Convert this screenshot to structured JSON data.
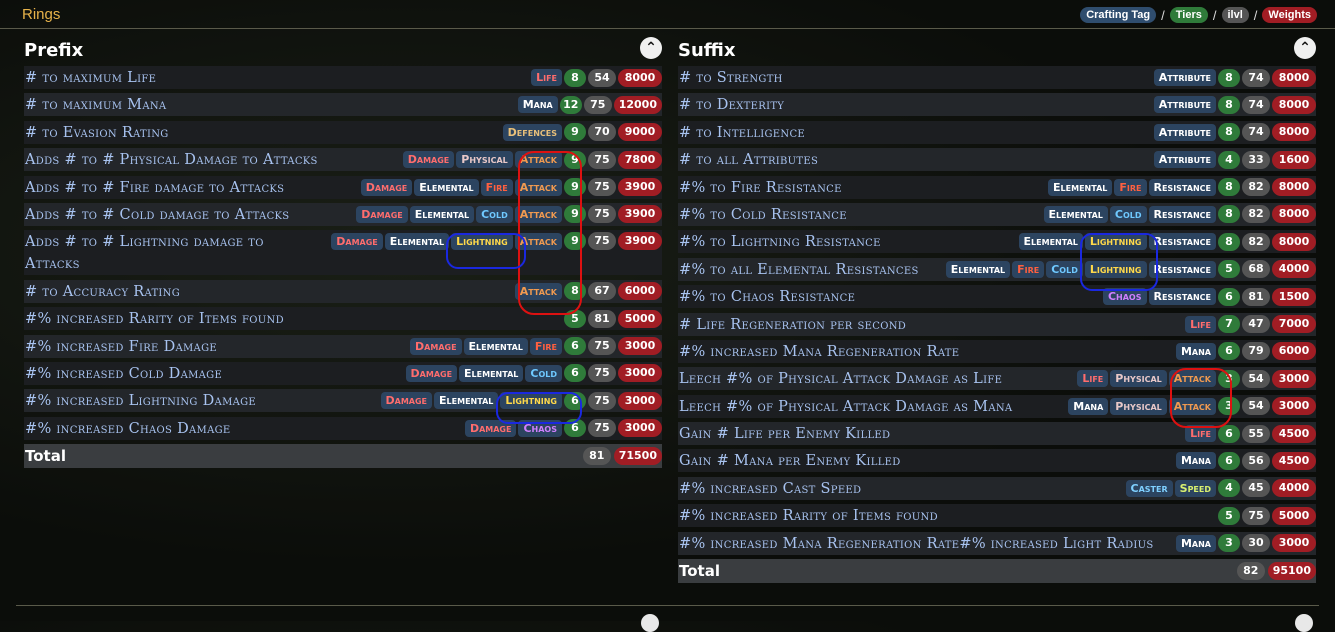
{
  "page": {
    "title": "Rings"
  },
  "legend": {
    "tag": "Crafting Tag",
    "tiers": "Tiers",
    "ilvl": "ilvl",
    "weights": "Weights",
    "sep": "/"
  },
  "prefix": {
    "title": "Prefix",
    "rows": [
      {
        "mod": "# to maximum Life",
        "tags": [
          [
            "Life",
            "life"
          ]
        ],
        "tier": "8",
        "ilvl": "54",
        "weight": "8000"
      },
      {
        "mod": "# to maximum Mana",
        "tags": [
          [
            "Mana",
            "mana"
          ]
        ],
        "tier": "12",
        "ilvl": "75",
        "weight": "12000"
      },
      {
        "mod": "# to Evasion Rating",
        "tags": [
          [
            "Defences",
            "defences"
          ]
        ],
        "tier": "9",
        "ilvl": "70",
        "weight": "9000"
      },
      {
        "mod": "Adds # to # Physical Damage to Attacks",
        "tags": [
          [
            "Damage",
            "damage"
          ],
          [
            "Physical",
            "physical"
          ],
          [
            "Attack",
            "attack"
          ]
        ],
        "tier": "9",
        "ilvl": "75",
        "weight": "7800"
      },
      {
        "mod": "Adds # to # Fire damage to Attacks",
        "tags": [
          [
            "Damage",
            "damage"
          ],
          [
            "Elemental",
            "elemental"
          ],
          [
            "Fire",
            "fire"
          ],
          [
            "Attack",
            "attack"
          ]
        ],
        "tier": "9",
        "ilvl": "75",
        "weight": "3900"
      },
      {
        "mod": "Adds # to # Cold damage to Attacks",
        "tags": [
          [
            "Damage",
            "damage"
          ],
          [
            "Elemental",
            "elemental"
          ],
          [
            "Cold",
            "cold"
          ],
          [
            "Attack",
            "attack"
          ]
        ],
        "tier": "9",
        "ilvl": "75",
        "weight": "3900"
      },
      {
        "mod": "Adds # to # Lightning damage to Attacks",
        "tags": [
          [
            "Damage",
            "damage"
          ],
          [
            "Elemental",
            "elemental"
          ],
          [
            "Lightning",
            "lightning"
          ],
          [
            "Attack",
            "attack"
          ]
        ],
        "tier": "9",
        "ilvl": "75",
        "weight": "3900",
        "tall": true
      },
      {
        "mod": "# to Accuracy Rating",
        "tags": [
          [
            "Attack",
            "attack"
          ]
        ],
        "tier": "8",
        "ilvl": "67",
        "weight": "6000"
      },
      {
        "mod": "#% increased Rarity of Items found",
        "tags": [],
        "tier": "5",
        "ilvl": "81",
        "weight": "5000"
      },
      {
        "mod": "#% increased Fire Damage",
        "tags": [
          [
            "Damage",
            "damage"
          ],
          [
            "Elemental",
            "elemental"
          ],
          [
            "Fire",
            "fire"
          ]
        ],
        "tier": "6",
        "ilvl": "75",
        "weight": "3000"
      },
      {
        "mod": "#% increased Cold Damage",
        "tags": [
          [
            "Damage",
            "damage"
          ],
          [
            "Elemental",
            "elemental"
          ],
          [
            "Cold",
            "cold"
          ]
        ],
        "tier": "6",
        "ilvl": "75",
        "weight": "3000"
      },
      {
        "mod": "#% increased Lightning Damage",
        "tags": [
          [
            "Damage",
            "damage"
          ],
          [
            "Elemental",
            "elemental"
          ],
          [
            "Lightning",
            "lightning"
          ]
        ],
        "tier": "6",
        "ilvl": "75",
        "weight": "3000"
      },
      {
        "mod": "#% increased Chaos Damage",
        "tags": [
          [
            "Damage",
            "damage"
          ],
          [
            "Chaos",
            "chaos"
          ]
        ],
        "tier": "6",
        "ilvl": "75",
        "weight": "3000"
      }
    ],
    "total": {
      "label": "Total",
      "ilvl": "81",
      "weight": "71500"
    }
  },
  "suffix": {
    "title": "Suffix",
    "rows": [
      {
        "mod": "# to Strength",
        "tags": [
          [
            "Attribute",
            "attribute"
          ]
        ],
        "tier": "8",
        "ilvl": "74",
        "weight": "8000"
      },
      {
        "mod": "# to Dexterity",
        "tags": [
          [
            "Attribute",
            "attribute"
          ]
        ],
        "tier": "8",
        "ilvl": "74",
        "weight": "8000"
      },
      {
        "mod": "# to Intelligence",
        "tags": [
          [
            "Attribute",
            "attribute"
          ]
        ],
        "tier": "8",
        "ilvl": "74",
        "weight": "8000"
      },
      {
        "mod": "# to all Attributes",
        "tags": [
          [
            "Attribute",
            "attribute"
          ]
        ],
        "tier": "4",
        "ilvl": "33",
        "weight": "1600"
      },
      {
        "mod": "#% to Fire Resistance",
        "tags": [
          [
            "Elemental",
            "elemental"
          ],
          [
            "Fire",
            "fire"
          ],
          [
            "Resistance",
            "resistance"
          ]
        ],
        "tier": "8",
        "ilvl": "82",
        "weight": "8000"
      },
      {
        "mod": "#% to Cold Resistance",
        "tags": [
          [
            "Elemental",
            "elemental"
          ],
          [
            "Cold",
            "cold"
          ],
          [
            "Resistance",
            "resistance"
          ]
        ],
        "tier": "8",
        "ilvl": "82",
        "weight": "8000"
      },
      {
        "mod": "#% to Lightning Resistance",
        "tags": [
          [
            "Elemental",
            "elemental"
          ],
          [
            "Lightning",
            "lightning"
          ],
          [
            "Resistance",
            "resistance"
          ]
        ],
        "tier": "8",
        "ilvl": "82",
        "weight": "8000"
      },
      {
        "mod": "#% to all Elemental Resistances",
        "tags": [
          [
            "Elemental",
            "elemental"
          ],
          [
            "Fire",
            "fire"
          ],
          [
            "Cold",
            "cold"
          ],
          [
            "Lightning",
            "lightning"
          ],
          [
            "Resistance",
            "resistance"
          ]
        ],
        "tier": "5",
        "ilvl": "68",
        "weight": "4000"
      },
      {
        "mod": "#% to Chaos Resistance",
        "tags": [
          [
            "Chaos",
            "chaos"
          ],
          [
            "Resistance",
            "resistance"
          ]
        ],
        "tier": "6",
        "ilvl": "81",
        "weight": "1500"
      },
      {
        "mod": "# Life Regeneration per second",
        "tags": [
          [
            "Life",
            "life"
          ]
        ],
        "tier": "7",
        "ilvl": "47",
        "weight": "7000"
      },
      {
        "mod": "#% increased Mana Regeneration Rate",
        "tags": [
          [
            "Mana",
            "mana"
          ]
        ],
        "tier": "6",
        "ilvl": "79",
        "weight": "6000"
      },
      {
        "mod": "Leech #% of Physical Attack Damage as Life",
        "tags": [
          [
            "Life",
            "life"
          ],
          [
            "Physical",
            "physical"
          ],
          [
            "Attack",
            "attack"
          ]
        ],
        "tier": "3",
        "ilvl": "54",
        "weight": "3000"
      },
      {
        "mod": "Leech #% of Physical Attack Damage as Mana",
        "tags": [
          [
            "Mana",
            "mana"
          ],
          [
            "Physical",
            "physical"
          ],
          [
            "Attack",
            "attack"
          ]
        ],
        "tier": "3",
        "ilvl": "54",
        "weight": "3000"
      },
      {
        "mod": "Gain # Life per Enemy Killed",
        "tags": [
          [
            "Life",
            "life"
          ]
        ],
        "tier": "6",
        "ilvl": "55",
        "weight": "4500"
      },
      {
        "mod": "Gain # Mana per Enemy Killed",
        "tags": [
          [
            "Mana",
            "mana"
          ]
        ],
        "tier": "6",
        "ilvl": "56",
        "weight": "4500"
      },
      {
        "mod": "#% increased Cast Speed",
        "tags": [
          [
            "Caster",
            "caster"
          ],
          [
            "Speed",
            "speed"
          ]
        ],
        "tier": "4",
        "ilvl": "45",
        "weight": "4000"
      },
      {
        "mod": "#% increased Rarity of Items found",
        "tags": [],
        "tier": "5",
        "ilvl": "75",
        "weight": "5000"
      },
      {
        "mod": "#% increased Mana Regeneration Rate#% increased Light Radius",
        "tags": [
          [
            "Mana",
            "mana"
          ]
        ],
        "tier": "3",
        "ilvl": "30",
        "weight": "3000"
      }
    ],
    "total": {
      "label": "Total",
      "ilvl": "82",
      "weight": "95100"
    }
  },
  "colors": {
    "accent": "#e7b34a",
    "tier": "#2f7b3a",
    "ilvl": "#555555",
    "weight": "#a11d24",
    "tag": "#2c4460"
  },
  "icons": {
    "collapse": "chevron-up-icon"
  }
}
